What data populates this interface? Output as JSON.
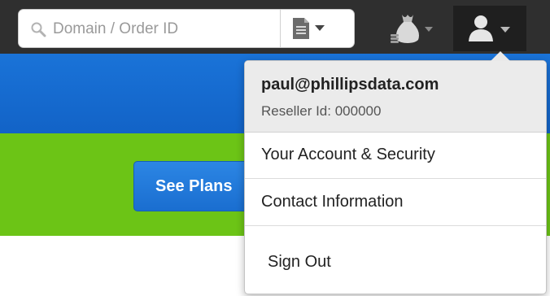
{
  "header": {
    "search": {
      "placeholder": "Domain / Order ID",
      "value": ""
    },
    "icons": {
      "search": "search-icon",
      "document": "document-icon",
      "money_bag": "money-bag-icon",
      "user": "user-icon"
    }
  },
  "banner": {
    "see_plans_label": "See Plans"
  },
  "user_menu": {
    "email": "paul@phillipsdata.com",
    "reseller": "Reseller Id: 000000",
    "items": [
      {
        "label": "Your Account & Security"
      },
      {
        "label": "Contact Information"
      },
      {
        "label": "Sign Out"
      }
    ]
  },
  "colors": {
    "topbar": "#2f2f2f",
    "blue_band": "#1a6ed0",
    "green_band": "#6cc416"
  }
}
